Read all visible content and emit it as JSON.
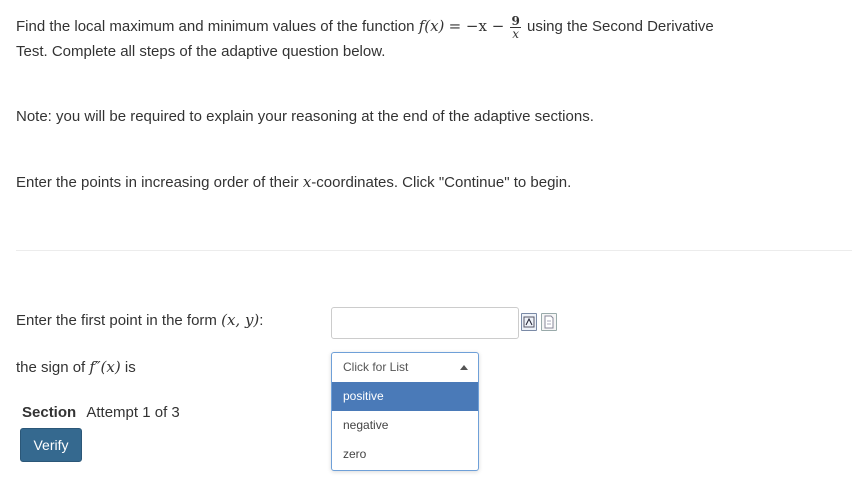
{
  "question": {
    "intro": "Find the local maximum and minimum values of the function",
    "f_name": "f",
    "f_arg": "(x)",
    "rhs_start": "= −x −",
    "frac_num": "9",
    "frac_den": "x",
    "intro_end": "using the Second Derivative",
    "line2": "Test. Complete all steps of the adaptive question below.",
    "note": "Note: you will be required to explain your reasoning at the end of the adaptive sections.",
    "order_pre": "Enter the points in increasing order of their",
    "order_var": "x",
    "order_post": "-coordinates. Click \"Continue\" to begin."
  },
  "step": {
    "point_prompt": "Enter the first point in the form",
    "point_form": "(x, y)",
    "point_colon": ":",
    "point_value": "",
    "sign_pre": "the sign of",
    "sign_f": "f″",
    "sign_arg": "(x)",
    "sign_post": "is",
    "select": {
      "placeholder": "Click for List",
      "options": [
        "positive",
        "negative",
        "zero"
      ],
      "highlighted": "positive"
    }
  },
  "section": {
    "label": "Section",
    "attempt": "Attempt 1 of 3",
    "verify_label": "Verify"
  }
}
